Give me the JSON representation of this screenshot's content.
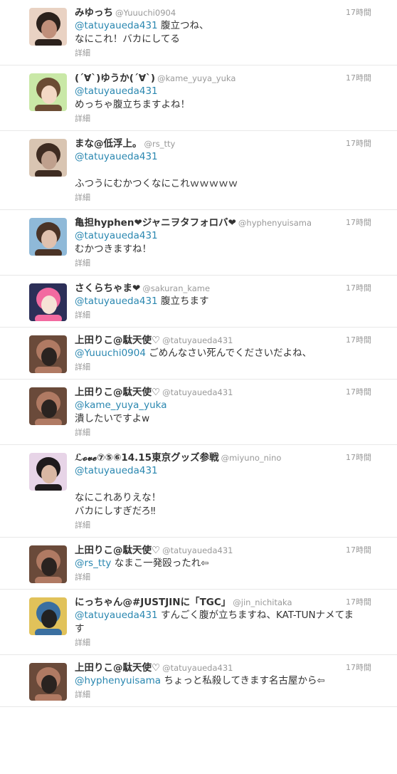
{
  "tweets": [
    {
      "name": "みゆっち",
      "handle": "@Yuuuchi0904",
      "time": "17時間",
      "lines": [
        [
          {
            "m": "@tatuyaueda431"
          },
          {
            "t": " 腹立つね、"
          }
        ],
        [
          {
            "t": "なにこれ！バカにしてる"
          }
        ]
      ],
      "details": "詳細",
      "avatar": [
        "#e9d2c3",
        "#2b211c",
        "#c08f7a"
      ]
    },
    {
      "name": "(´∀`)ゆうか(´∀`)",
      "handle": "@kame_yuya_yuka",
      "time": "17時間",
      "lines": [
        [
          {
            "m": "@tatuyaueda431"
          }
        ],
        [
          {
            "t": "めっちゃ腹立ちますよね！"
          }
        ]
      ],
      "details": "詳細",
      "avatar": [
        "#c9e8a7",
        "#6b4c34",
        "#f3d8c5"
      ]
    },
    {
      "name": "まな@低浮上。",
      "handle": "@rs_tty",
      "time": "17時間",
      "lines": [
        [
          {
            "m": "@tatuyaueda431"
          }
        ],
        [],
        [
          {
            "t": "ふつうにむかつくなにこれｗｗｗｗｗ"
          }
        ]
      ],
      "details": "詳細",
      "avatar": [
        "#d9c5b2",
        "#3e2c22",
        "#bfa08d"
      ]
    },
    {
      "name": "亀担hyphen❤ジャニヲタフォロバ❤",
      "handle": "@hyphenyuisama",
      "time": "17時間",
      "lines": [
        [
          {
            "m": "@tatuyaueda431"
          }
        ],
        [
          {
            "t": "むかつきますね！"
          }
        ]
      ],
      "details": "詳細",
      "avatar": [
        "#8fb9d8",
        "#4a3326",
        "#e0c1ae"
      ]
    },
    {
      "name": "さくらちゃま❤",
      "handle": "@sakuran_kame",
      "time": "17時間",
      "lines": [
        [
          {
            "m": "@tatuyaueda431"
          },
          {
            "t": " 腹立ちます"
          }
        ]
      ],
      "details": "詳細",
      "avatar": [
        "#2c2f58",
        "#f26aa0",
        "#f5e3d6"
      ]
    },
    {
      "name": "上田りこ@駄天使♡",
      "handle": "@tatuyaueda431",
      "time": "17時間",
      "lines": [
        [
          {
            "m": "@Yuuuchi0904"
          },
          {
            "t": " ごめんなさい死んでくださいだよね、"
          }
        ]
      ],
      "details": "詳細",
      "avatar": [
        "#6a4a3a",
        "#b07a63",
        "#2a2320"
      ]
    },
    {
      "name": "上田りこ@駄天使♡",
      "handle": "@tatuyaueda431",
      "time": "17時間",
      "lines": [
        [
          {
            "m": "@kame_yuya_yuka"
          }
        ],
        [
          {
            "t": "潰したいですよw"
          }
        ]
      ],
      "details": "詳細",
      "avatar": [
        "#6a4a3a",
        "#b07a63",
        "#2a2320"
      ]
    },
    {
      "name": "ℒ𝓸𝓿𝓮⑦⑤⑥14.15東京グッズ参戦",
      "handle": "@miyuno_nino",
      "time": "17時間",
      "lines": [
        [
          {
            "m": "@tatuyaueda431"
          }
        ],
        [],
        [
          {
            "t": "なにこれありえな！"
          }
        ],
        [
          {
            "t": "バカにしすぎだろ‼"
          }
        ]
      ],
      "details": "詳細",
      "avatar": [
        "#e7d4e7",
        "#1e1a1c",
        "#d9b7a3"
      ]
    },
    {
      "name": "上田りこ@駄天使♡",
      "handle": "@tatuyaueda431",
      "time": "17時間",
      "lines": [
        [
          {
            "m": "@rs_tty"
          },
          {
            "t": " なまこ一発殴ったれ⇦"
          }
        ]
      ],
      "details": "詳細",
      "avatar": [
        "#6a4a3a",
        "#b07a63",
        "#2a2320"
      ]
    },
    {
      "name": "にっちゃん@#JUSTJINに「TGC」",
      "handle": "@jin_nichitaka",
      "time": "17時間",
      "lines": [
        [
          {
            "m": "@tatuyaueda431"
          },
          {
            "t": " すんごく腹が立ちますね、KAT-TUNナメてま"
          }
        ],
        [
          {
            "t": "す"
          }
        ]
      ],
      "details": "詳細",
      "avatar": [
        "#e1c25a",
        "#3a6fa0",
        "#222222"
      ]
    },
    {
      "name": "上田りこ@駄天使♡",
      "handle": "@tatuyaueda431",
      "time": "17時間",
      "lines": [
        [
          {
            "m": "@hyphenyuisama"
          },
          {
            "t": " ちょっと私殺してきます名古屋から⇦"
          }
        ]
      ],
      "details": "詳細",
      "avatar": [
        "#6a4a3a",
        "#b07a63",
        "#2a2320"
      ]
    }
  ]
}
